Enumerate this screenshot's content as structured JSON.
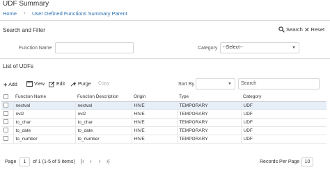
{
  "header": {
    "title": "UDF Summary",
    "breadcrumb": [
      "Home",
      "User Defined Functions Summary Parent"
    ]
  },
  "search": {
    "section_title": "Search and Filter",
    "search_label": "Search",
    "reset_label": "Reset",
    "function_name_label": "Function Name",
    "function_name_value": "",
    "category_label": "Category",
    "category_value": "--Select--"
  },
  "list": {
    "section_title": "List of UDFs",
    "toolbar": {
      "add": "Add",
      "view": "View",
      "edit": "Edit",
      "purge": "Purge",
      "copy": "Copy"
    },
    "sort_by_label": "Sort By",
    "sort_by_value": "",
    "search_placeholder": "Search",
    "columns": [
      "Function Name",
      "Function Description",
      "Origin",
      "Type",
      "Category"
    ],
    "rows": [
      [
        "nextval",
        "nextval",
        "HIVE",
        "TEMPORARY",
        "UDF"
      ],
      [
        "nvl2",
        "nvl2",
        "HIVE",
        "TEMPORARY",
        "UDF"
      ],
      [
        "to_char",
        "to_char",
        "HIVE",
        "TEMPORARY",
        "UDF"
      ],
      [
        "to_date",
        "to_date",
        "HIVE",
        "TEMPORARY",
        "UDF"
      ],
      [
        "to_number",
        "to_number",
        "HIVE",
        "TEMPORARY",
        "UDF"
      ]
    ]
  },
  "pagination": {
    "page_label": "Page",
    "page_value": "1",
    "of_text": "of 1 (1-5 of 5 items)",
    "records_label": "Records Per Page",
    "records_value": "10"
  },
  "colors": {
    "link": "#2a6fb1",
    "selected_row": "#e6eef8",
    "disabled": "#b3b3b3"
  }
}
